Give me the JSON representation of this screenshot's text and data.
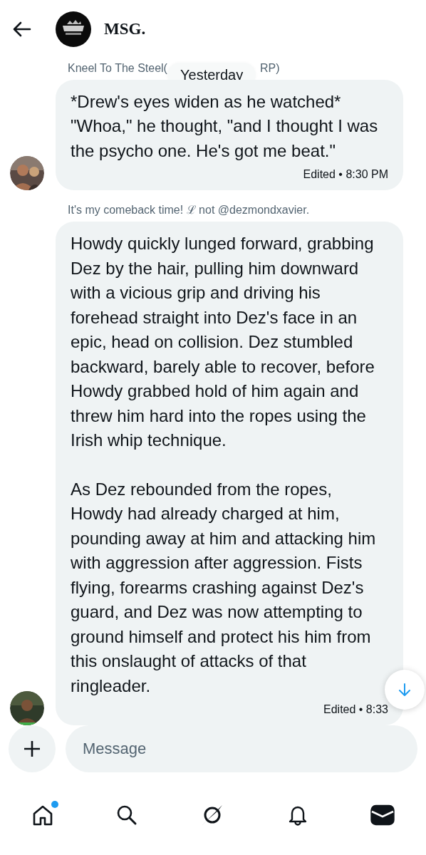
{
  "header": {
    "title": "MSG."
  },
  "date_divider": "Yesterday",
  "messages": [
    {
      "sender_parts": [
        "Kneel To The Steel(",
        "RP)"
      ],
      "paragraphs": [
        "*Drew's eyes widen as he watched* \"Whoa,\" he thought, \"and I thought I was the psycho one. He's got me beat.\""
      ],
      "meta": "Edited • 8:30 PM"
    },
    {
      "sender_parts": [
        "It's my comeback time! ℒ not @dezmondxavier."
      ],
      "paragraphs": [
        "Howdy quickly lunged forward, grabbing Dez by the hair, pulling him downward with a vicious grip and driving his forehead straight into Dez's face in an epic, head on collision. Dez stumbled backward, barely able to recover, before Howdy grabbed hold of him again and threw him hard into the ropes using the Irish whip technique.",
        "As Dez rebounded from the ropes, Howdy had already charged at him, pounding away at him and attacking him with aggression after aggression. Fists flying, forearms crashing against Dez's guard, and Dez was now attempting to ground himself and protect his him from this onslaught of attacks of that ringleader."
      ],
      "meta": "Edited • 8:33"
    }
  ],
  "composer": {
    "placeholder": "Message"
  },
  "nav": [
    {
      "kind": "home",
      "selected": false,
      "badge": true
    },
    {
      "kind": "search",
      "selected": false,
      "badge": false
    },
    {
      "kind": "grok",
      "selected": false,
      "badge": false
    },
    {
      "kind": "bell",
      "selected": false,
      "badge": false
    },
    {
      "kind": "mail",
      "selected": true,
      "badge": false
    }
  ]
}
